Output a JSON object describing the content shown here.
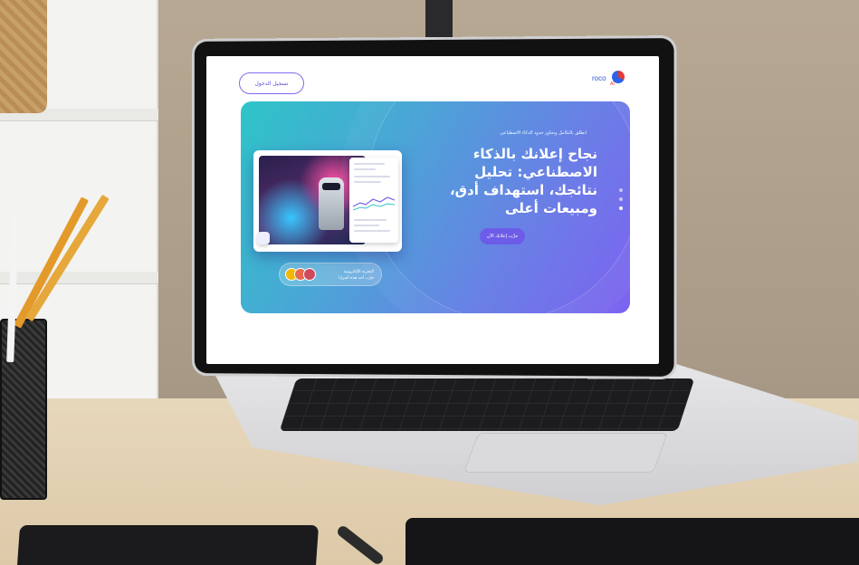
{
  "nav": {
    "login_label": "تسجيل الدخول",
    "logo_text": "roco",
    "logo_sub": "AI"
  },
  "hero": {
    "tagline": "انطلق بالتكامل وتجاوز حدود الذكاء الاصطناعي",
    "headline": "نجاح إعلانك بالذكاء الاصطناعي: تحليل نتائجك، استهداف أدق، ومبيعات أعلى",
    "cta_label": "جرِّب إعلانك الآن",
    "proof_line1": "التجربة الإلكترونية",
    "proof_line2": "جرّب أحد هذه المزايا"
  },
  "colors": {
    "hero_start": "#2ec4c8",
    "hero_end": "#7c63f0",
    "accent": "#6c5ce7",
    "brand_blue": "#3556d6",
    "brand_red": "#e53935"
  }
}
